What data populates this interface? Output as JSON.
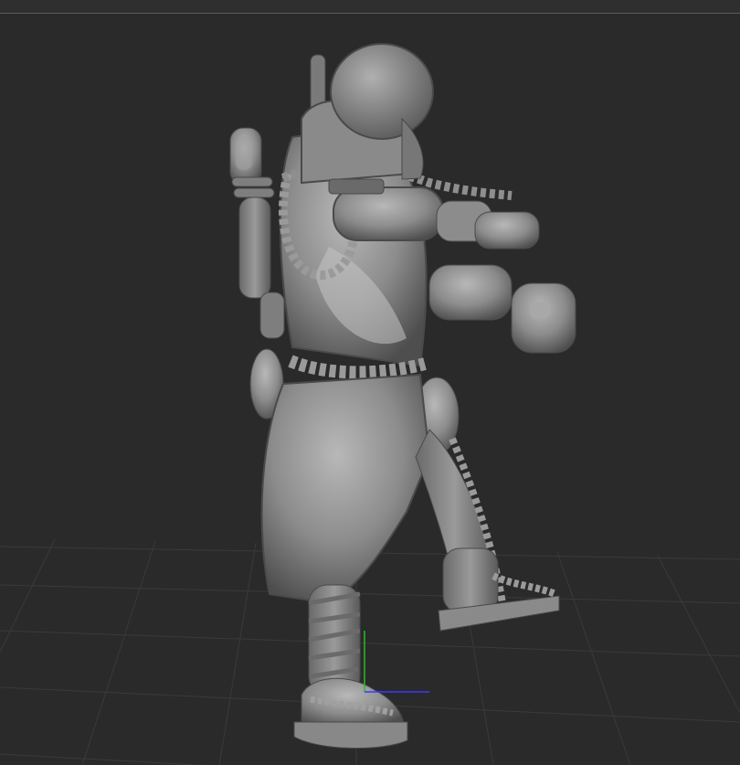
{
  "viewport": {
    "background_color": "#2a2a2a",
    "grid_color": "#3a3a3a",
    "model_color": "#8a8a8a",
    "axis_y_color": "#22c022",
    "axis_x_color": "#3a3aff"
  },
  "model": {
    "icon": "sculpted-character-model"
  }
}
